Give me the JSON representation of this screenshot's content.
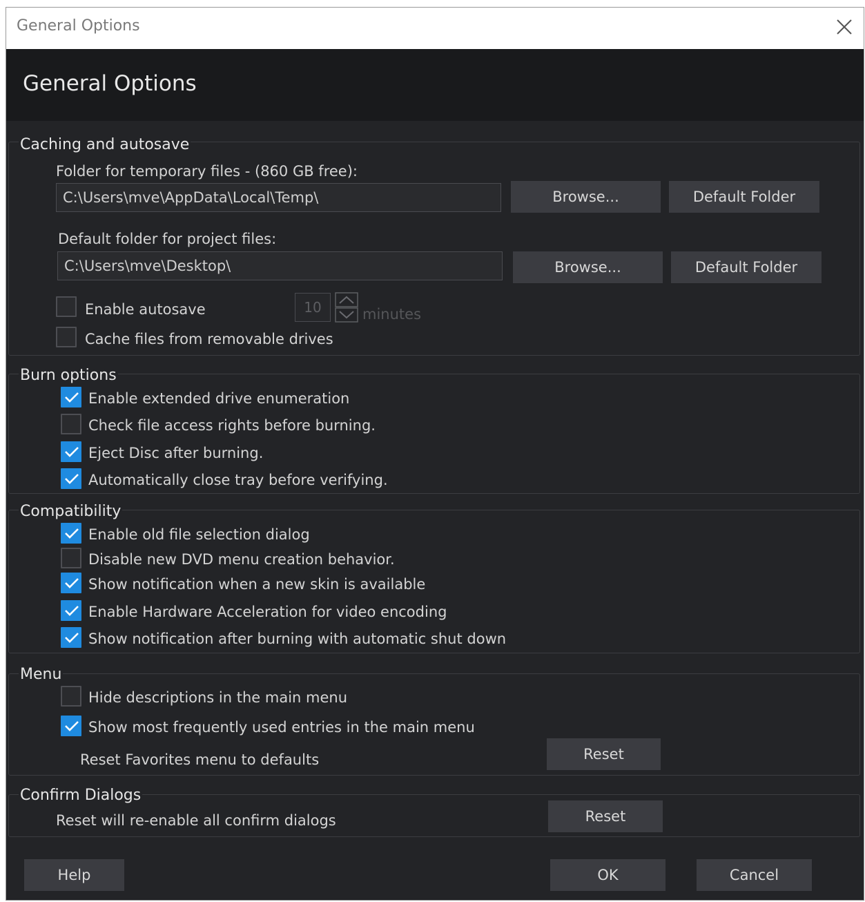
{
  "window": {
    "title": "General Options"
  },
  "header": {
    "title": "General Options"
  },
  "caching": {
    "title": "Caching and autosave",
    "temp_label": "Folder for temporary files - (860 GB free):",
    "temp_value": "C:\\Users\\mve\\AppData\\Local\\Temp\\",
    "project_label": "Default folder for project files:",
    "project_value": "C:\\Users\\mve\\Desktop\\",
    "browse_label": "Browse...",
    "default_folder_label": "Default Folder",
    "autosave_label": "Enable autosave",
    "autosave_checked": false,
    "autosave_minutes": "10",
    "minutes_label": "minutes",
    "removable_label": "Cache files from removable drives",
    "removable_checked": false
  },
  "burn": {
    "title": "Burn options",
    "items": [
      {
        "label": "Enable extended drive enumeration",
        "checked": true
      },
      {
        "label": "Check file access rights before burning.",
        "checked": false
      },
      {
        "label": "Eject Disc after burning.",
        "checked": true
      },
      {
        "label": "Automatically close tray before verifying.",
        "checked": true
      }
    ]
  },
  "compat": {
    "title": "Compatibility",
    "items": [
      {
        "label": "Enable old file selection dialog",
        "checked": true
      },
      {
        "label": "Disable new DVD menu creation behavior.",
        "checked": false
      },
      {
        "label": "Show notification when a new skin is available",
        "checked": true
      },
      {
        "label": "Enable Hardware Acceleration for video encoding",
        "checked": true
      },
      {
        "label": "Show notification after burning with automatic shut down",
        "checked": true
      }
    ]
  },
  "menu": {
    "title": "Menu",
    "items": [
      {
        "label": "Hide descriptions in the main menu",
        "checked": false
      },
      {
        "label": "Show most frequently used entries in the main menu",
        "checked": true
      }
    ],
    "reset_favorites_label": "Reset Favorites menu to defaults",
    "reset_button": "Reset"
  },
  "confirm": {
    "title": "Confirm Dialogs",
    "text": "Reset will re-enable all confirm dialogs",
    "reset_button": "Reset"
  },
  "footer": {
    "help": "Help",
    "ok": "OK",
    "cancel": "Cancel"
  },
  "colors": {
    "accent": "#1f8be0",
    "background": "#232427",
    "header": "#191a1c",
    "button": "#3b3c41"
  },
  "icons": {
    "close": "close-icon",
    "spin": "up-down-arrows-icon",
    "check": "checkmark-icon"
  }
}
